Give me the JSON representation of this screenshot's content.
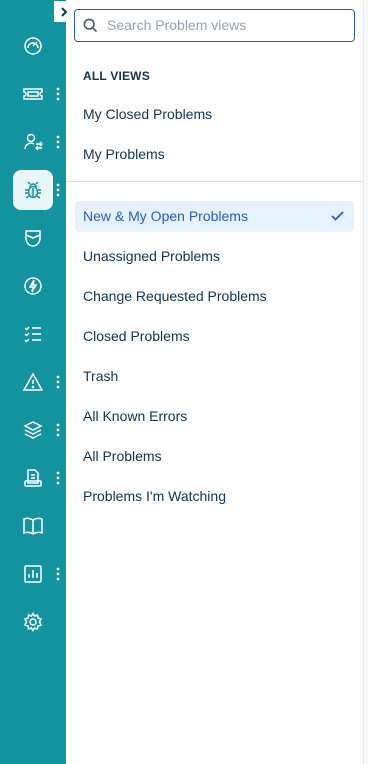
{
  "search": {
    "placeholder": "Search Problem views",
    "value": ""
  },
  "sections": {
    "all_views_title": "ALL VIEWS"
  },
  "custom_views": [
    "My Closed Problems",
    "My Problems"
  ],
  "default_views": [
    "New & My Open Problems",
    "Unassigned Problems",
    "Change Requested Problems",
    "Closed Problems",
    "Trash",
    "All Known Errors",
    "All Problems",
    "Problems I'm Watching"
  ],
  "selected_view": "New & My Open Problems",
  "sidebar": {
    "items": [
      {
        "icon": "dashboard-icon",
        "more": false
      },
      {
        "icon": "ticket-icon",
        "more": true
      },
      {
        "icon": "user-switch-icon",
        "more": true
      },
      {
        "icon": "bug-icon",
        "more": true,
        "active": true
      },
      {
        "icon": "shield-icon",
        "more": false
      },
      {
        "icon": "lightning-icon",
        "more": false
      },
      {
        "icon": "checklist-icon",
        "more": false
      },
      {
        "icon": "warning-icon",
        "more": true
      },
      {
        "icon": "layers-icon",
        "more": true
      },
      {
        "icon": "document-icon",
        "more": true
      },
      {
        "icon": "book-icon",
        "more": false
      },
      {
        "icon": "bar-chart-icon",
        "more": true
      },
      {
        "icon": "gear-icon",
        "more": false
      }
    ]
  },
  "colors": {
    "rail": "#13939f",
    "accent": "#2c5cc5",
    "selected_bg": "#e5f2fd"
  }
}
